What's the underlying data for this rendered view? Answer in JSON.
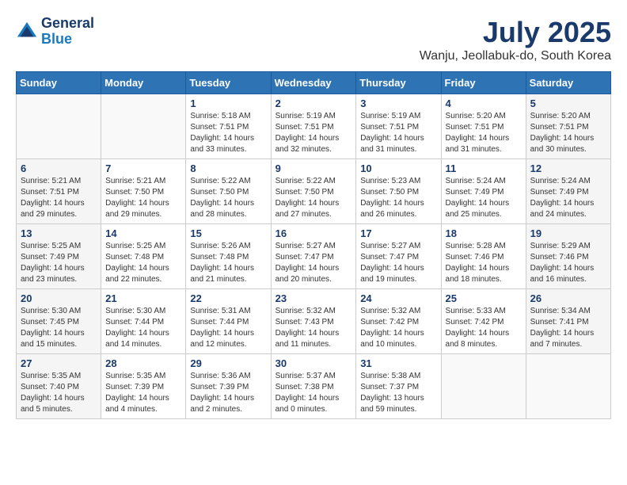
{
  "logo": {
    "general": "General",
    "blue": "Blue"
  },
  "title": "July 2025",
  "location": "Wanju, Jeollabuk-do, South Korea",
  "weekdays": [
    "Sunday",
    "Monday",
    "Tuesday",
    "Wednesday",
    "Thursday",
    "Friday",
    "Saturday"
  ],
  "weeks": [
    [
      {
        "day": "",
        "info": ""
      },
      {
        "day": "",
        "info": ""
      },
      {
        "day": "1",
        "info": "Sunrise: 5:18 AM\nSunset: 7:51 PM\nDaylight: 14 hours\nand 33 minutes."
      },
      {
        "day": "2",
        "info": "Sunrise: 5:19 AM\nSunset: 7:51 PM\nDaylight: 14 hours\nand 32 minutes."
      },
      {
        "day": "3",
        "info": "Sunrise: 5:19 AM\nSunset: 7:51 PM\nDaylight: 14 hours\nand 31 minutes."
      },
      {
        "day": "4",
        "info": "Sunrise: 5:20 AM\nSunset: 7:51 PM\nDaylight: 14 hours\nand 31 minutes."
      },
      {
        "day": "5",
        "info": "Sunrise: 5:20 AM\nSunset: 7:51 PM\nDaylight: 14 hours\nand 30 minutes."
      }
    ],
    [
      {
        "day": "6",
        "info": "Sunrise: 5:21 AM\nSunset: 7:51 PM\nDaylight: 14 hours\nand 29 minutes."
      },
      {
        "day": "7",
        "info": "Sunrise: 5:21 AM\nSunset: 7:50 PM\nDaylight: 14 hours\nand 29 minutes."
      },
      {
        "day": "8",
        "info": "Sunrise: 5:22 AM\nSunset: 7:50 PM\nDaylight: 14 hours\nand 28 minutes."
      },
      {
        "day": "9",
        "info": "Sunrise: 5:22 AM\nSunset: 7:50 PM\nDaylight: 14 hours\nand 27 minutes."
      },
      {
        "day": "10",
        "info": "Sunrise: 5:23 AM\nSunset: 7:50 PM\nDaylight: 14 hours\nand 26 minutes."
      },
      {
        "day": "11",
        "info": "Sunrise: 5:24 AM\nSunset: 7:49 PM\nDaylight: 14 hours\nand 25 minutes."
      },
      {
        "day": "12",
        "info": "Sunrise: 5:24 AM\nSunset: 7:49 PM\nDaylight: 14 hours\nand 24 minutes."
      }
    ],
    [
      {
        "day": "13",
        "info": "Sunrise: 5:25 AM\nSunset: 7:49 PM\nDaylight: 14 hours\nand 23 minutes."
      },
      {
        "day": "14",
        "info": "Sunrise: 5:25 AM\nSunset: 7:48 PM\nDaylight: 14 hours\nand 22 minutes."
      },
      {
        "day": "15",
        "info": "Sunrise: 5:26 AM\nSunset: 7:48 PM\nDaylight: 14 hours\nand 21 minutes."
      },
      {
        "day": "16",
        "info": "Sunrise: 5:27 AM\nSunset: 7:47 PM\nDaylight: 14 hours\nand 20 minutes."
      },
      {
        "day": "17",
        "info": "Sunrise: 5:27 AM\nSunset: 7:47 PM\nDaylight: 14 hours\nand 19 minutes."
      },
      {
        "day": "18",
        "info": "Sunrise: 5:28 AM\nSunset: 7:46 PM\nDaylight: 14 hours\nand 18 minutes."
      },
      {
        "day": "19",
        "info": "Sunrise: 5:29 AM\nSunset: 7:46 PM\nDaylight: 14 hours\nand 16 minutes."
      }
    ],
    [
      {
        "day": "20",
        "info": "Sunrise: 5:30 AM\nSunset: 7:45 PM\nDaylight: 14 hours\nand 15 minutes."
      },
      {
        "day": "21",
        "info": "Sunrise: 5:30 AM\nSunset: 7:44 PM\nDaylight: 14 hours\nand 14 minutes."
      },
      {
        "day": "22",
        "info": "Sunrise: 5:31 AM\nSunset: 7:44 PM\nDaylight: 14 hours\nand 12 minutes."
      },
      {
        "day": "23",
        "info": "Sunrise: 5:32 AM\nSunset: 7:43 PM\nDaylight: 14 hours\nand 11 minutes."
      },
      {
        "day": "24",
        "info": "Sunrise: 5:32 AM\nSunset: 7:42 PM\nDaylight: 14 hours\nand 10 minutes."
      },
      {
        "day": "25",
        "info": "Sunrise: 5:33 AM\nSunset: 7:42 PM\nDaylight: 14 hours\nand 8 minutes."
      },
      {
        "day": "26",
        "info": "Sunrise: 5:34 AM\nSunset: 7:41 PM\nDaylight: 14 hours\nand 7 minutes."
      }
    ],
    [
      {
        "day": "27",
        "info": "Sunrise: 5:35 AM\nSunset: 7:40 PM\nDaylight: 14 hours\nand 5 minutes."
      },
      {
        "day": "28",
        "info": "Sunrise: 5:35 AM\nSunset: 7:39 PM\nDaylight: 14 hours\nand 4 minutes."
      },
      {
        "day": "29",
        "info": "Sunrise: 5:36 AM\nSunset: 7:39 PM\nDaylight: 14 hours\nand 2 minutes."
      },
      {
        "day": "30",
        "info": "Sunrise: 5:37 AM\nSunset: 7:38 PM\nDaylight: 14 hours\nand 0 minutes."
      },
      {
        "day": "31",
        "info": "Sunrise: 5:38 AM\nSunset: 7:37 PM\nDaylight: 13 hours\nand 59 minutes."
      },
      {
        "day": "",
        "info": ""
      },
      {
        "day": "",
        "info": ""
      }
    ]
  ]
}
